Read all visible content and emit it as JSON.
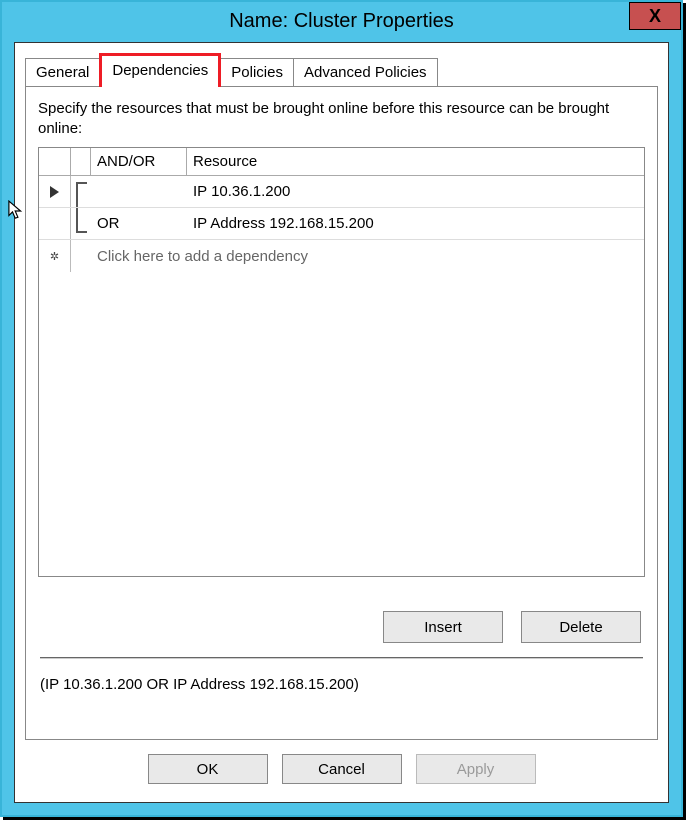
{
  "window": {
    "title": "Name: Cluster Properties",
    "close_glyph": "X"
  },
  "tabs": {
    "general": "General",
    "dependencies": "Dependencies",
    "policies": "Policies",
    "advanced": "Advanced Policies"
  },
  "panel": {
    "instruction": "Specify the resources that must be brought online before this resource can be brought online:",
    "headers": {
      "andor": "AND/OR",
      "resource": "Resource"
    },
    "rows": [
      {
        "andor": "",
        "resource": "IP 10.36.1.200"
      },
      {
        "andor": "OR",
        "resource": "IP Address 192.168.15.200"
      }
    ],
    "placeholder": "Click here to add a dependency",
    "buttons": {
      "insert": "Insert",
      "delete": "Delete"
    },
    "expression": "(IP 10.36.1.200  OR IP Address 192.168.15.200)"
  },
  "dialog_buttons": {
    "ok": "OK",
    "cancel": "Cancel",
    "apply": "Apply"
  }
}
